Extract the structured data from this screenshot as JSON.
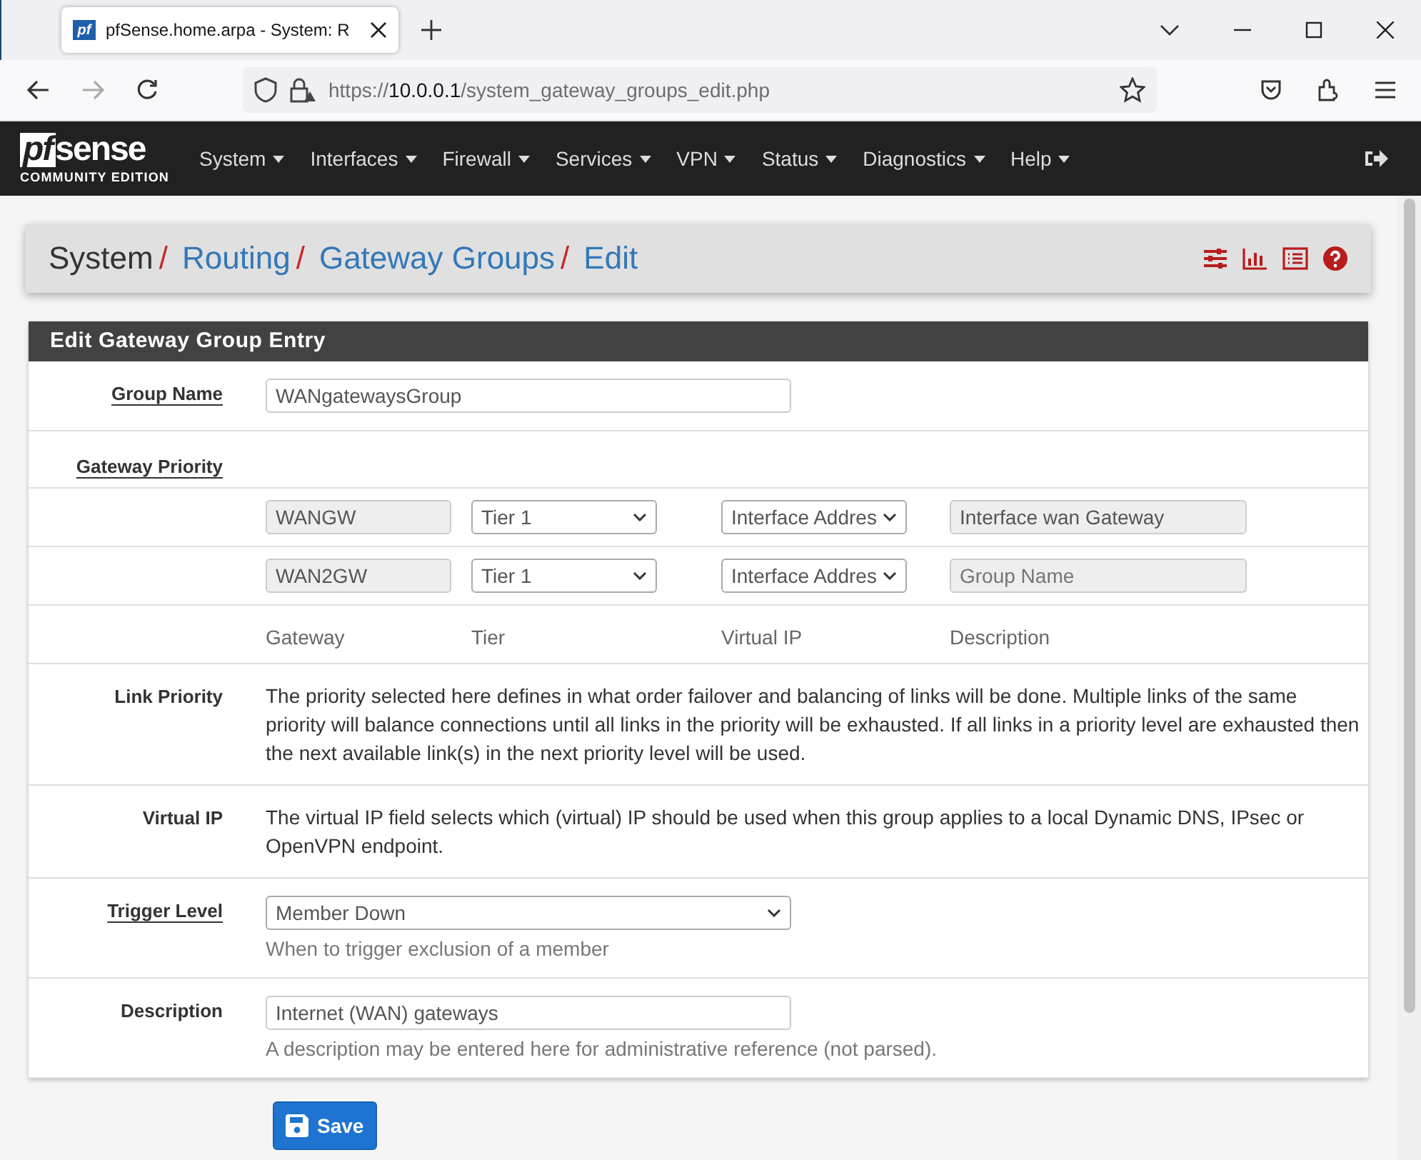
{
  "browser": {
    "favicon_text": "pf",
    "tab_title": "pfSense.home.arpa - System: R",
    "url_prefix": "https://",
    "url_host": "10.0.0.1",
    "url_path": "/system_gateway_groups_edit.php"
  },
  "brand": {
    "logo_pf": "pf",
    "logo_sense": "sense",
    "edition": "COMMUNITY EDITION"
  },
  "menu": [
    {
      "label": "System"
    },
    {
      "label": "Interfaces"
    },
    {
      "label": "Firewall"
    },
    {
      "label": "Services"
    },
    {
      "label": "VPN"
    },
    {
      "label": "Status"
    },
    {
      "label": "Diagnostics"
    },
    {
      "label": "Help"
    }
  ],
  "breadcrumb": [
    {
      "label": "System",
      "link": false,
      "separator": "/"
    },
    {
      "label": "Routing",
      "link": true,
      "separator": "/"
    },
    {
      "label": "Gateway Groups",
      "link": true,
      "separator": "/"
    },
    {
      "label": "Edit",
      "link": true
    }
  ],
  "panel_title": "Edit Gateway Group Entry",
  "group_name": {
    "label": "Group Name",
    "value": "WANgatewaysGroup"
  },
  "gateway_priority": {
    "label": "Gateway Priority",
    "rows": [
      {
        "gateway": "WANGW",
        "tier": "Tier 1",
        "virtual_ip": "Interface Addres",
        "description": "Interface wan Gateway"
      },
      {
        "gateway": "WAN2GW",
        "tier": "Tier 1",
        "virtual_ip": "Interface Addres",
        "placeholder": "Group Name"
      }
    ],
    "columns": [
      "Gateway",
      "Tier",
      "Virtual IP",
      "Description"
    ]
  },
  "link_priority": {
    "label": "Link Priority",
    "text": "The priority selected here defines in what order failover and balancing of links will be done. Multiple links of the same priority will balance connections until all links in the priority will be exhausted. If all links in a priority level are exhausted then the next available link(s) in the next priority level will be used."
  },
  "virtual_ip": {
    "label": "Virtual IP",
    "text": "The virtual IP field selects which (virtual) IP should be used when this group applies to a local Dynamic DNS, IPsec or OpenVPN endpoint."
  },
  "trigger_level": {
    "label": "Trigger Level",
    "value": "Member Down",
    "help": "When to trigger exclusion of a member"
  },
  "description": {
    "label": "Description",
    "value": "Internet (WAN) gateways",
    "help": "A description may be entered here for administrative reference (not parsed)."
  },
  "save_button": "Save"
}
